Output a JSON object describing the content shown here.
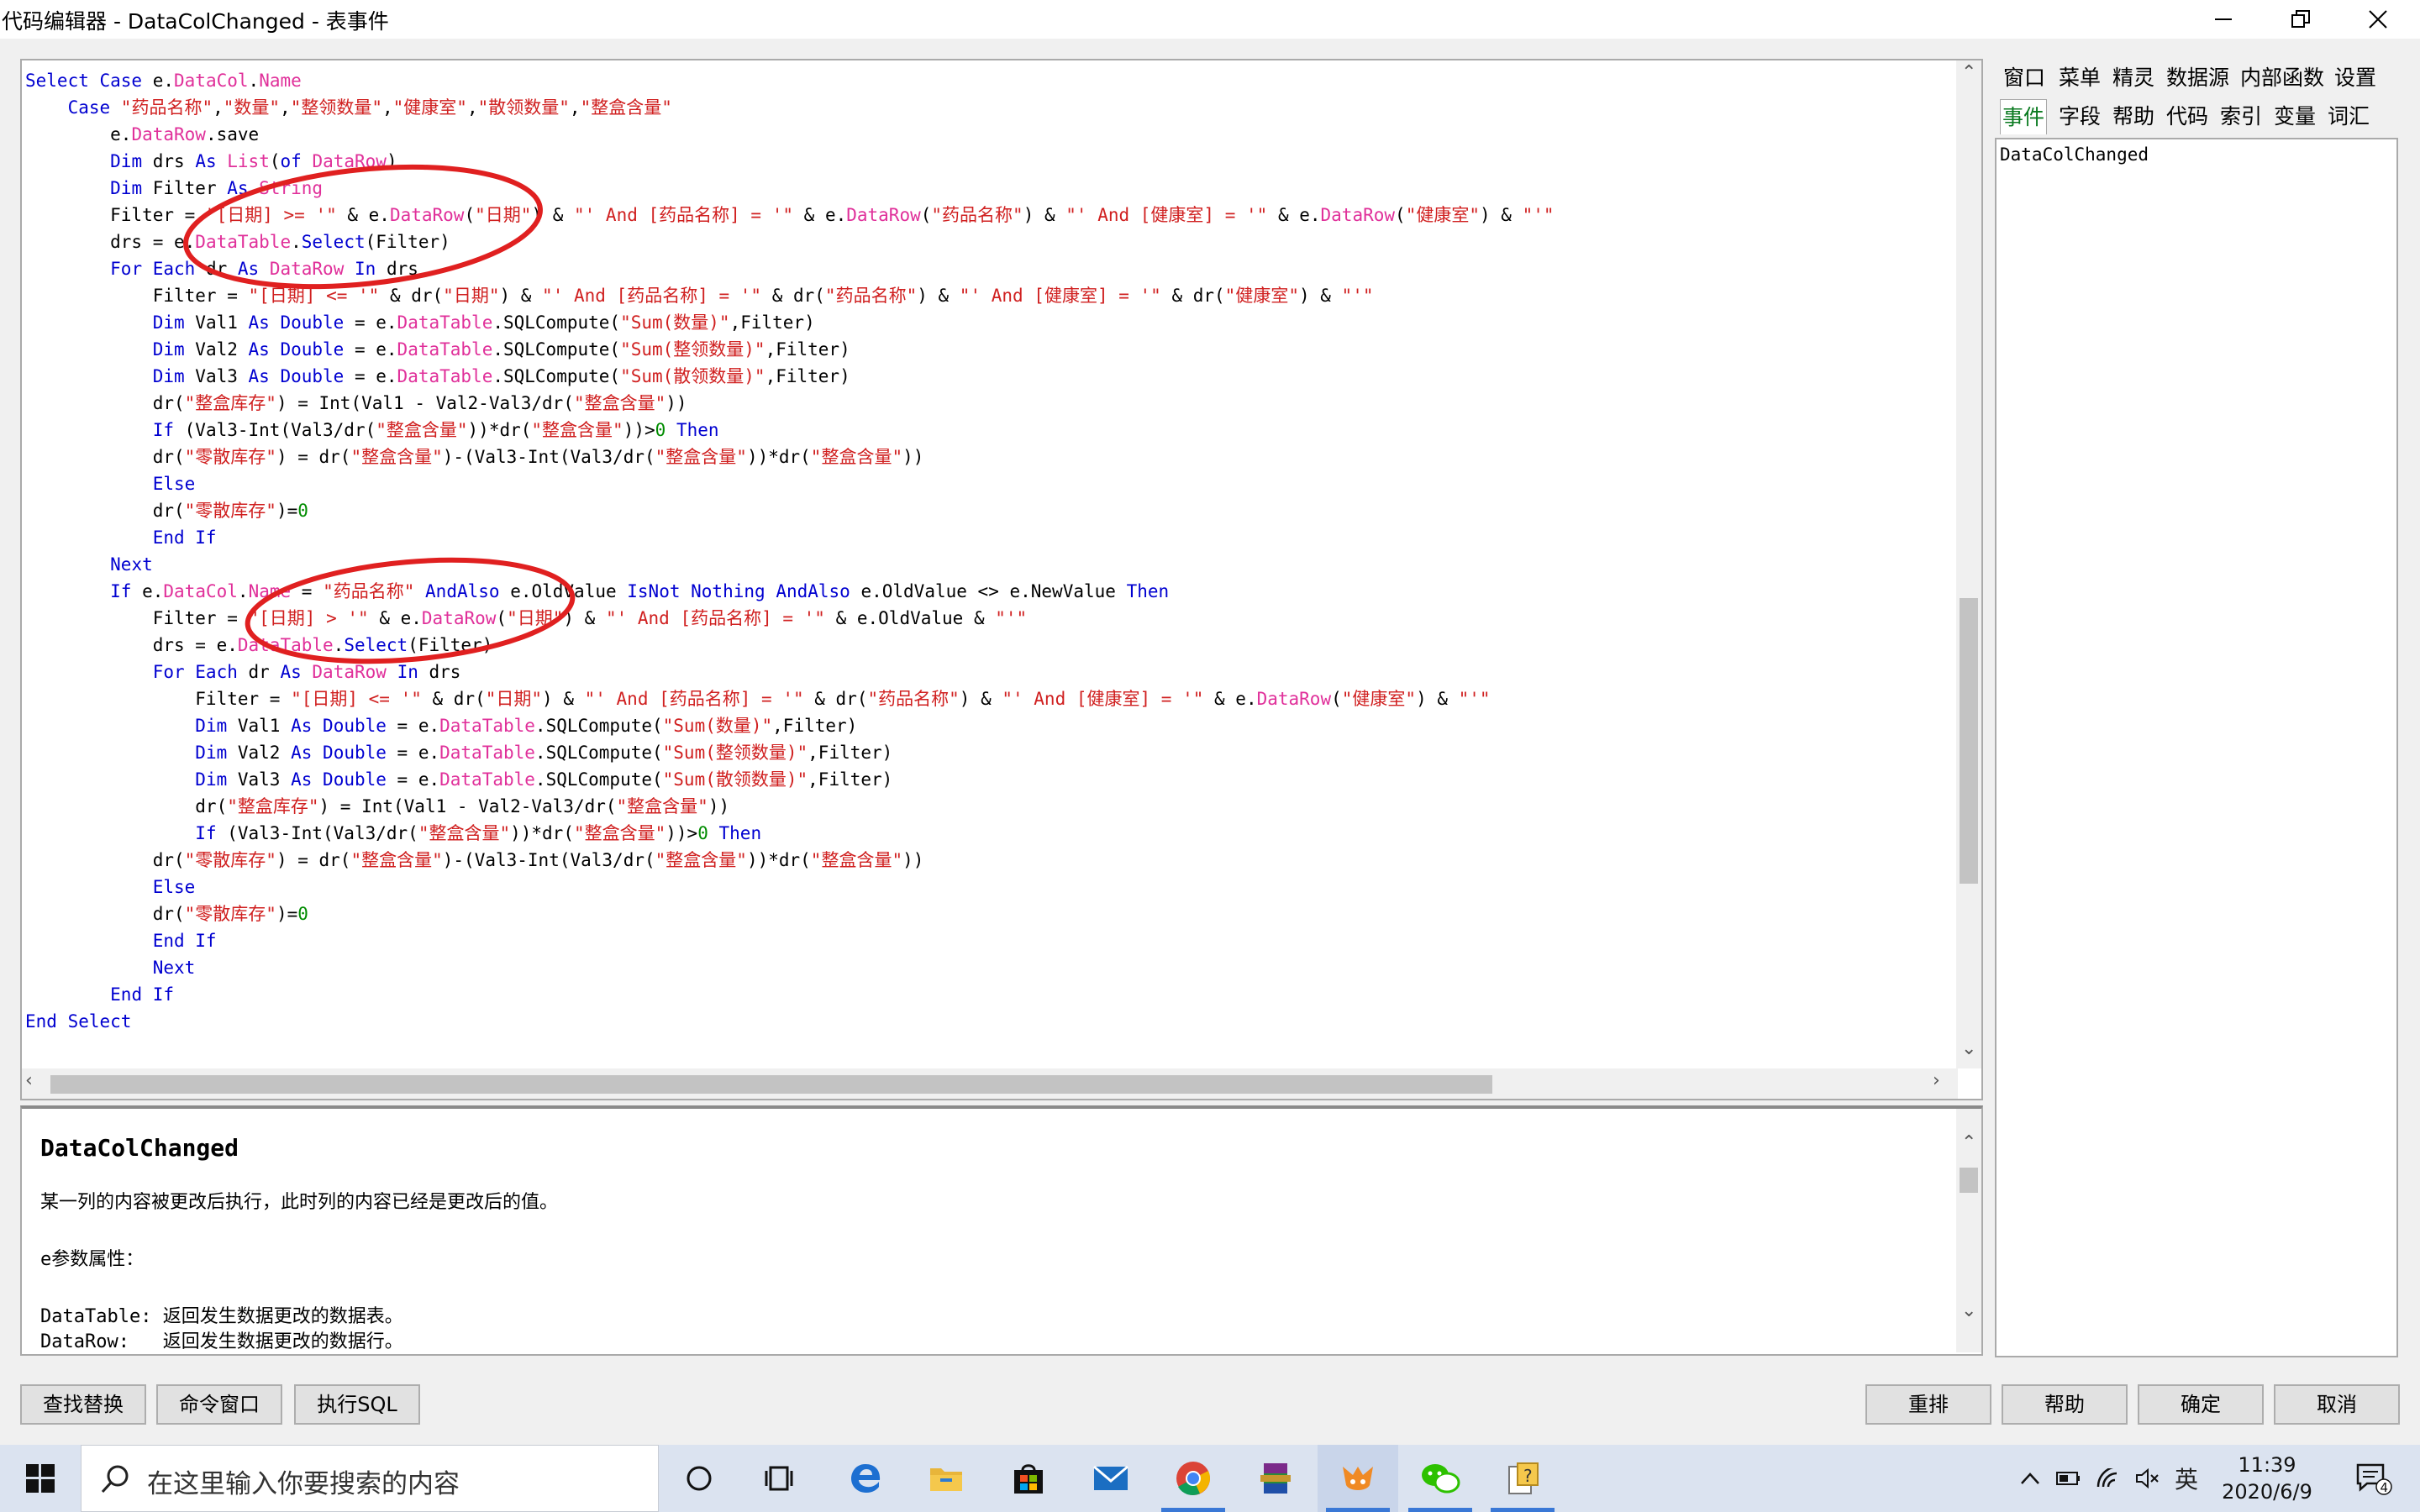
{
  "window": {
    "title": "代码编辑器 - DataColChanged - 表事件",
    "controls": [
      "minimize-icon",
      "restore-icon",
      "close-icon"
    ]
  },
  "code": {
    "lines": [
      [
        [
          "k",
          "Select Case "
        ],
        [
          "t",
          "e."
        ],
        [
          "p",
          "DataCol"
        ],
        [
          "t",
          "."
        ],
        [
          "p",
          "Name"
        ]
      ],
      [
        [
          "t",
          "    "
        ],
        [
          "k",
          "Case "
        ],
        [
          "s",
          "\"药品名称\""
        ],
        [
          "t",
          ","
        ],
        [
          "s",
          "\"数量\""
        ],
        [
          "t",
          ","
        ],
        [
          "s",
          "\"整领数量\""
        ],
        [
          "t",
          ","
        ],
        [
          "s",
          "\"健康室\""
        ],
        [
          "t",
          ","
        ],
        [
          "s",
          "\"散领数量\""
        ],
        [
          "t",
          ","
        ],
        [
          "s",
          "\"整盒含量\""
        ]
      ],
      [
        [
          "t",
          "        e."
        ],
        [
          "p",
          "DataRow"
        ],
        [
          "t",
          ".save"
        ]
      ],
      [
        [
          "t",
          "        "
        ],
        [
          "k",
          "Dim"
        ],
        [
          "t",
          " drs "
        ],
        [
          "k",
          "As"
        ],
        [
          "t",
          " "
        ],
        [
          "p",
          "List"
        ],
        [
          "t",
          "("
        ],
        [
          "k",
          "of"
        ],
        [
          "t",
          " "
        ],
        [
          "p",
          "DataRow"
        ],
        [
          "t",
          ")"
        ]
      ],
      [
        [
          "t",
          "        "
        ],
        [
          "k",
          "Dim"
        ],
        [
          "t",
          " Filter "
        ],
        [
          "k",
          "As"
        ],
        [
          "t",
          " "
        ],
        [
          "p",
          "String"
        ]
      ],
      [
        [
          "t",
          "        Filter = "
        ],
        [
          "s",
          "\"[日期] >= '\""
        ],
        [
          "t",
          " & e."
        ],
        [
          "p",
          "DataRow"
        ],
        [
          "t",
          "("
        ],
        [
          "s",
          "\"日期\""
        ],
        [
          "t",
          ") & "
        ],
        [
          "s",
          "\"' And [药品名称] = '\""
        ],
        [
          "t",
          " & e."
        ],
        [
          "p",
          "DataRow"
        ],
        [
          "t",
          "("
        ],
        [
          "s",
          "\"药品名称\""
        ],
        [
          "t",
          ") & "
        ],
        [
          "s",
          "\"' And [健康室] = '\""
        ],
        [
          "t",
          " & e."
        ],
        [
          "p",
          "DataRow"
        ],
        [
          "t",
          "("
        ],
        [
          "s",
          "\"健康室\""
        ],
        [
          "t",
          ") & "
        ],
        [
          "s",
          "\"'\""
        ]
      ],
      [
        [
          "t",
          "        drs = e."
        ],
        [
          "p",
          "DataTable"
        ],
        [
          "t",
          "."
        ],
        [
          "k",
          "Select"
        ],
        [
          "t",
          "(Filter)"
        ]
      ],
      [
        [
          "t",
          "        "
        ],
        [
          "k",
          "For Each"
        ],
        [
          "t",
          " dr "
        ],
        [
          "k",
          "As"
        ],
        [
          "t",
          " "
        ],
        [
          "p",
          "DataRow"
        ],
        [
          "t",
          " "
        ],
        [
          "k",
          "In"
        ],
        [
          "t",
          " drs"
        ]
      ],
      [
        [
          "t",
          "            Filter = "
        ],
        [
          "s",
          "\"[日期] <= '\""
        ],
        [
          "t",
          " & dr("
        ],
        [
          "s",
          "\"日期\""
        ],
        [
          "t",
          ") & "
        ],
        [
          "s",
          "\"' And [药品名称] = '\""
        ],
        [
          "t",
          " & dr("
        ],
        [
          "s",
          "\"药品名称\""
        ],
        [
          "t",
          ") & "
        ],
        [
          "s",
          "\"' And [健康室] = '\""
        ],
        [
          "t",
          " & dr("
        ],
        [
          "s",
          "\"健康室\""
        ],
        [
          "t",
          ") & "
        ],
        [
          "s",
          "\"'\""
        ]
      ],
      [
        [
          "t",
          "            "
        ],
        [
          "k",
          "Dim"
        ],
        [
          "t",
          " Val1 "
        ],
        [
          "k",
          "As"
        ],
        [
          "t",
          " "
        ],
        [
          "k",
          "Double"
        ],
        [
          "t",
          " = e."
        ],
        [
          "p",
          "DataTable"
        ],
        [
          "t",
          ".SQLCompute("
        ],
        [
          "s",
          "\"Sum(数量)\""
        ],
        [
          "t",
          ",Filter)"
        ]
      ],
      [
        [
          "t",
          "            "
        ],
        [
          "k",
          "Dim"
        ],
        [
          "t",
          " Val2 "
        ],
        [
          "k",
          "As"
        ],
        [
          "t",
          " "
        ],
        [
          "k",
          "Double"
        ],
        [
          "t",
          " = e."
        ],
        [
          "p",
          "DataTable"
        ],
        [
          "t",
          ".SQLCompute("
        ],
        [
          "s",
          "\"Sum(整领数量)\""
        ],
        [
          "t",
          ",Filter)"
        ]
      ],
      [
        [
          "t",
          "            "
        ],
        [
          "k",
          "Dim"
        ],
        [
          "t",
          " Val3 "
        ],
        [
          "k",
          "As"
        ],
        [
          "t",
          " "
        ],
        [
          "k",
          "Double"
        ],
        [
          "t",
          " = e."
        ],
        [
          "p",
          "DataTable"
        ],
        [
          "t",
          ".SQLCompute("
        ],
        [
          "s",
          "\"Sum(散领数量)\""
        ],
        [
          "t",
          ",Filter)"
        ]
      ],
      [
        [
          "t",
          "            dr("
        ],
        [
          "s",
          "\"整盒库存\""
        ],
        [
          "t",
          ") = Int(Val1 - Val2-Val3/dr("
        ],
        [
          "s",
          "\"整盒含量\""
        ],
        [
          "t",
          "))"
        ]
      ],
      [
        [
          "t",
          "            "
        ],
        [
          "k",
          "If"
        ],
        [
          "t",
          " (Val3-Int(Val3/dr("
        ],
        [
          "s",
          "\"整盒含量\""
        ],
        [
          "t",
          "))*dr("
        ],
        [
          "s",
          "\"整盒含量\""
        ],
        [
          "t",
          "))>"
        ],
        [
          "n",
          "0"
        ],
        [
          "t",
          " "
        ],
        [
          "k",
          "Then"
        ]
      ],
      [
        [
          "t",
          "            dr("
        ],
        [
          "s",
          "\"零散库存\""
        ],
        [
          "t",
          ") = dr("
        ],
        [
          "s",
          "\"整盒含量\""
        ],
        [
          "t",
          ")-(Val3-Int(Val3/dr("
        ],
        [
          "s",
          "\"整盒含量\""
        ],
        [
          "t",
          "))*dr("
        ],
        [
          "s",
          "\"整盒含量\""
        ],
        [
          "t",
          "))"
        ]
      ],
      [
        [
          "t",
          "            "
        ],
        [
          "k",
          "Else"
        ]
      ],
      [
        [
          "t",
          "            dr("
        ],
        [
          "s",
          "\"零散库存\""
        ],
        [
          "t",
          ")="
        ],
        [
          "n",
          "0"
        ]
      ],
      [
        [
          "t",
          "            "
        ],
        [
          "k",
          "End If"
        ]
      ],
      [
        [
          "t",
          "        "
        ],
        [
          "k",
          "Next"
        ]
      ],
      [
        [
          "t",
          "        "
        ],
        [
          "k",
          "If"
        ],
        [
          "t",
          " e."
        ],
        [
          "p",
          "DataCol"
        ],
        [
          "t",
          "."
        ],
        [
          "p",
          "Name"
        ],
        [
          "t",
          " = "
        ],
        [
          "s",
          "\"药品名称\""
        ],
        [
          "t",
          " "
        ],
        [
          "k",
          "AndAlso"
        ],
        [
          "t",
          " e.OldValue "
        ],
        [
          "k",
          "IsNot"
        ],
        [
          "t",
          " "
        ],
        [
          "k",
          "Nothing"
        ],
        [
          "t",
          " "
        ],
        [
          "k",
          "AndAlso"
        ],
        [
          "t",
          " e.OldValue <> e.NewValue "
        ],
        [
          "k",
          "Then"
        ]
      ],
      [
        [
          "t",
          "            Filter = "
        ],
        [
          "s",
          "\"[日期] > '\""
        ],
        [
          "t",
          " & e."
        ],
        [
          "p",
          "DataRow"
        ],
        [
          "t",
          "("
        ],
        [
          "s",
          "\"日期\""
        ],
        [
          "t",
          ") & "
        ],
        [
          "s",
          "\"' And [药品名称] = '\""
        ],
        [
          "t",
          " & e.OldValue & "
        ],
        [
          "s",
          "\"'\""
        ]
      ],
      [
        [
          "t",
          "            drs = e."
        ],
        [
          "p",
          "DataTable"
        ],
        [
          "t",
          "."
        ],
        [
          "k",
          "Select"
        ],
        [
          "t",
          "(Filter)"
        ]
      ],
      [
        [
          "t",
          "            "
        ],
        [
          "k",
          "For Each"
        ],
        [
          "t",
          " dr "
        ],
        [
          "k",
          "As"
        ],
        [
          "t",
          " "
        ],
        [
          "p",
          "DataRow"
        ],
        [
          "t",
          " "
        ],
        [
          "k",
          "In"
        ],
        [
          "t",
          " drs"
        ]
      ],
      [
        [
          "t",
          "                Filter = "
        ],
        [
          "s",
          "\"[日期] <= '\""
        ],
        [
          "t",
          " & dr("
        ],
        [
          "s",
          "\"日期\""
        ],
        [
          "t",
          ") & "
        ],
        [
          "s",
          "\"' And [药品名称] = '\""
        ],
        [
          "t",
          " & dr("
        ],
        [
          "s",
          "\"药品名称\""
        ],
        [
          "t",
          ") & "
        ],
        [
          "s",
          "\"' And [健康室] = '\""
        ],
        [
          "t",
          " & e."
        ],
        [
          "p",
          "DataRow"
        ],
        [
          "t",
          "("
        ],
        [
          "s",
          "\"健康室\""
        ],
        [
          "t",
          ") & "
        ],
        [
          "s",
          "\"'\""
        ]
      ],
      [
        [
          "t",
          "                "
        ],
        [
          "k",
          "Dim"
        ],
        [
          "t",
          " Val1 "
        ],
        [
          "k",
          "As"
        ],
        [
          "t",
          " "
        ],
        [
          "k",
          "Double"
        ],
        [
          "t",
          " = e."
        ],
        [
          "p",
          "DataTable"
        ],
        [
          "t",
          ".SQLCompute("
        ],
        [
          "s",
          "\"Sum(数量)\""
        ],
        [
          "t",
          ",Filter)"
        ]
      ],
      [
        [
          "t",
          "                "
        ],
        [
          "k",
          "Dim"
        ],
        [
          "t",
          " Val2 "
        ],
        [
          "k",
          "As"
        ],
        [
          "t",
          " "
        ],
        [
          "k",
          "Double"
        ],
        [
          "t",
          " = e."
        ],
        [
          "p",
          "DataTable"
        ],
        [
          "t",
          ".SQLCompute("
        ],
        [
          "s",
          "\"Sum(整领数量)\""
        ],
        [
          "t",
          ",Filter)"
        ]
      ],
      [
        [
          "t",
          "                "
        ],
        [
          "k",
          "Dim"
        ],
        [
          "t",
          " Val3 "
        ],
        [
          "k",
          "As"
        ],
        [
          "t",
          " "
        ],
        [
          "k",
          "Double"
        ],
        [
          "t",
          " = e."
        ],
        [
          "p",
          "DataTable"
        ],
        [
          "t",
          ".SQLCompute("
        ],
        [
          "s",
          "\"Sum(散领数量)\""
        ],
        [
          "t",
          ",Filter)"
        ]
      ],
      [
        [
          "t",
          "                dr("
        ],
        [
          "s",
          "\"整盒库存\""
        ],
        [
          "t",
          ") = Int(Val1 - Val2-Val3/dr("
        ],
        [
          "s",
          "\"整盒含量\""
        ],
        [
          "t",
          "))"
        ]
      ],
      [
        [
          "t",
          "                "
        ],
        [
          "k",
          "If"
        ],
        [
          "t",
          " (Val3-Int(Val3/dr("
        ],
        [
          "s",
          "\"整盒含量\""
        ],
        [
          "t",
          "))*dr("
        ],
        [
          "s",
          "\"整盒含量\""
        ],
        [
          "t",
          "))>"
        ],
        [
          "n",
          "0"
        ],
        [
          "t",
          " "
        ],
        [
          "k",
          "Then"
        ]
      ],
      [
        [
          "t",
          "            dr("
        ],
        [
          "s",
          "\"零散库存\""
        ],
        [
          "t",
          ") = dr("
        ],
        [
          "s",
          "\"整盒含量\""
        ],
        [
          "t",
          ")-(Val3-Int(Val3/dr("
        ],
        [
          "s",
          "\"整盒含量\""
        ],
        [
          "t",
          "))*dr("
        ],
        [
          "s",
          "\"整盒含量\""
        ],
        [
          "t",
          "))"
        ]
      ],
      [
        [
          "t",
          "            "
        ],
        [
          "k",
          "Else"
        ]
      ],
      [
        [
          "t",
          "            dr("
        ],
        [
          "s",
          "\"零散库存\""
        ],
        [
          "t",
          ")="
        ],
        [
          "n",
          "0"
        ]
      ],
      [
        [
          "t",
          "            "
        ],
        [
          "k",
          "End If"
        ]
      ],
      [
        [
          "t",
          "            "
        ],
        [
          "k",
          "Next"
        ]
      ],
      [
        [
          "t",
          "        "
        ],
        [
          "k",
          "End If"
        ]
      ],
      [
        [
          "k",
          "End Select"
        ]
      ]
    ]
  },
  "help": {
    "title": "DataColChanged",
    "description": "某一列的内容被更改后执行，此时列的内容已经是更改后的值。",
    "params_heading": "e参数属性：",
    "params": [
      "DataTable: 返回发生数据更改的数据表。",
      "DataRow:   返回发生数据更改的数据行。"
    ]
  },
  "sidebar": {
    "tabs_row1": [
      "窗口",
      "菜单",
      "精灵",
      "数据源",
      "内部函数",
      "设置"
    ],
    "tabs_row2": [
      "事件",
      "字段",
      "帮助",
      "代码",
      "索引",
      "变量",
      "词汇"
    ],
    "active_tab": "事件",
    "selected_item": "DataColChanged"
  },
  "buttons": {
    "find_replace": "查找替换",
    "command_window": "命令窗口",
    "execute_sql": "执行SQL",
    "rearrange": "重排",
    "help": "帮助",
    "ok": "确定",
    "cancel": "取消"
  },
  "taskbar": {
    "search_placeholder": "在这里输入你要搜索的内容",
    "apps": [
      "cortana-icon",
      "task-view-icon",
      "edge-icon",
      "file-explorer-icon",
      "store-icon",
      "mail-icon",
      "chrome-icon",
      "winrar-icon",
      "foxtable-icon",
      "wechat-icon",
      "help-app-icon"
    ],
    "ime": "英",
    "time": "11:39",
    "date": "2020/6/9",
    "notification_count": "4"
  },
  "colors": {
    "keyword": "#0000d0",
    "string": "#d02020",
    "property": "#e0309a",
    "number": "#008c00",
    "active_tab": "#0a7a20",
    "annotation": "#e02020"
  }
}
